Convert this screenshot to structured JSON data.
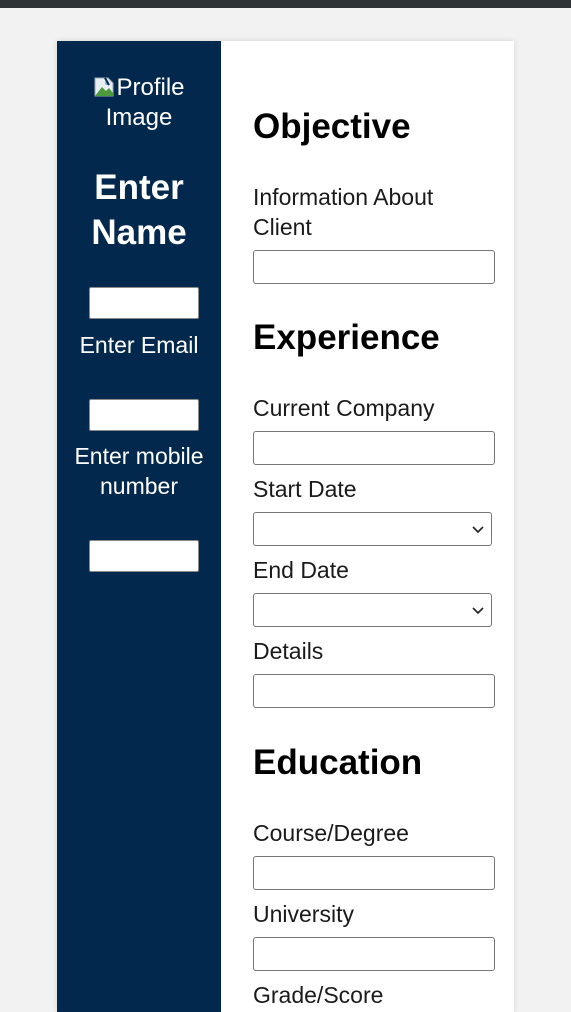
{
  "colors": {
    "sidebar_bg": "#02284d",
    "page_bg": "#f2f2f2",
    "card_bg": "#ffffff",
    "top_bar": "#303336"
  },
  "sidebar": {
    "profile_image_alt": "Profile Image",
    "name_placeholder_text": "Enter Name",
    "name_value": "",
    "email_label": "Enter Email",
    "email_value": "",
    "mobile_label": "Enter mobile number",
    "mobile_value": ""
  },
  "objective": {
    "title": "Objective",
    "client_info_label": "Information About Client",
    "client_info_value": ""
  },
  "experience": {
    "title": "Experience",
    "company_label": "Current Company",
    "company_value": "",
    "start_date_label": "Start Date",
    "start_date_value": "",
    "end_date_label": "End Date",
    "end_date_value": "",
    "details_label": "Details",
    "details_value": ""
  },
  "education": {
    "title": "Education",
    "course_label": "Course/Degree",
    "course_value": "",
    "university_label": "University",
    "university_value": "",
    "grade_label": "Grade/Score"
  },
  "icons": {
    "broken_image": "broken-image-icon",
    "select_arrow": "chevron-down-icon"
  }
}
